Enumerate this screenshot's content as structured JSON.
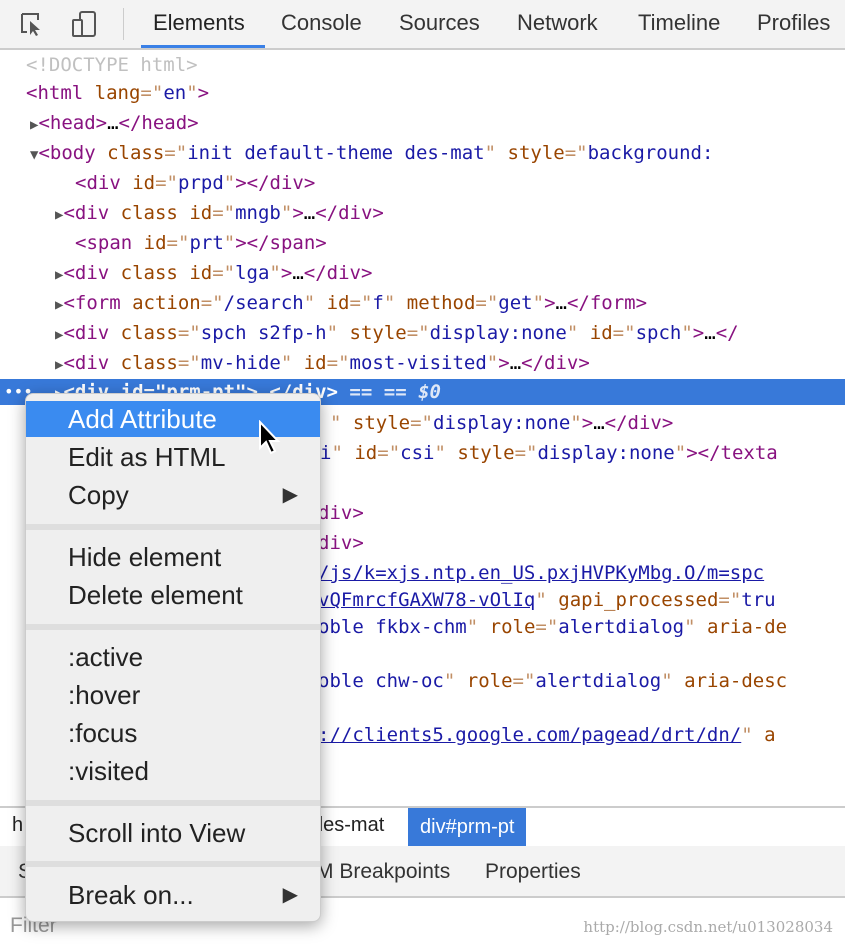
{
  "toolbar": {
    "icons": [
      "inspect-element-icon",
      "device-mode-icon"
    ],
    "tabs": [
      "Elements",
      "Console",
      "Sources",
      "Network",
      "Timeline",
      "Profiles"
    ],
    "active_tab": "Elements"
  },
  "dom_tree": {
    "lines": [
      {
        "text": "<!DOCTYPE html>"
      },
      {
        "text": "<html lang=\"en\">"
      },
      {
        "text": "<head>…</head>",
        "expander": "collapsed"
      },
      {
        "text": "<body class=\"init default-theme des-mat\" style=\"background:",
        "expander": "expanded"
      },
      {
        "text": "<div id=\"prpd\"></div>"
      },
      {
        "text": "<div class id=\"mngb\">…</div>",
        "expander": "collapsed"
      },
      {
        "text": "<span id=\"prt\"></span>"
      },
      {
        "text": "<div class id=\"lga\">…</div>",
        "expander": "collapsed"
      },
      {
        "text": "<form action=\"/search\" id=\"f\" method=\"get\">…</form>",
        "expander": "collapsed"
      },
      {
        "text": "<div class=\"spch s2fp-h\" style=\"display:none\" id=\"spch\">…</",
        "expander": "collapsed"
      },
      {
        "text": "<div class=\"mv-hide\" id=\"most-visited\">…</div>",
        "expander": "collapsed"
      },
      {
        "text": "<div id=\"prm-pt\">…</div> == $0",
        "expander": "collapsed",
        "selected": true
      },
      {
        "text": "\" style=\"display:none\">…</div>"
      },
      {
        "text": "i\" id=\"csi\" style=\"display:none\"></texta"
      },
      {
        "text": ""
      },
      {
        "text": "div>"
      },
      {
        "text": "div>"
      },
      {
        "text": "/js/k=xjs.ntp.en_US.pxjHVPKyMbg.O/m=spc"
      },
      {
        "text": "vQFmrcfGAXW78-vOlIq\" gapi_processed=\"tru"
      },
      {
        "text": "oble fkbx-chm\" role=\"alertdialog\" aria-de"
      },
      {
        "text": ""
      },
      {
        "text": "oble chw-oc\" role=\"alertdialog\" aria-desc"
      },
      {
        "text": ""
      },
      {
        "text": "://clients5.google.com/pagead/drt/dn/\" a"
      }
    ],
    "selected_suffix": "== $0"
  },
  "breadcrumbs": {
    "items": [
      "h",
      "des-mat",
      "div#prm-pt"
    ],
    "selected": "div#prm-pt"
  },
  "subtabs": {
    "items": [
      "S",
      "M Breakpoints",
      "Properties"
    ]
  },
  "filter": {
    "placeholder": "Filter"
  },
  "watermark": "http://blog.csdn.net/u013028034",
  "context_menu": {
    "items": [
      {
        "label": "Add Attribute",
        "highlighted": true
      },
      {
        "label": "Edit as HTML"
      },
      {
        "label": "Copy",
        "submenu": true
      },
      {
        "label": "Hide element"
      },
      {
        "label": "Delete element"
      },
      {
        "label": ":active"
      },
      {
        "label": ":hover"
      },
      {
        "label": ":focus"
      },
      {
        "label": ":visited"
      },
      {
        "label": "Scroll into View"
      },
      {
        "label": "Break on...",
        "submenu": true
      }
    ]
  }
}
